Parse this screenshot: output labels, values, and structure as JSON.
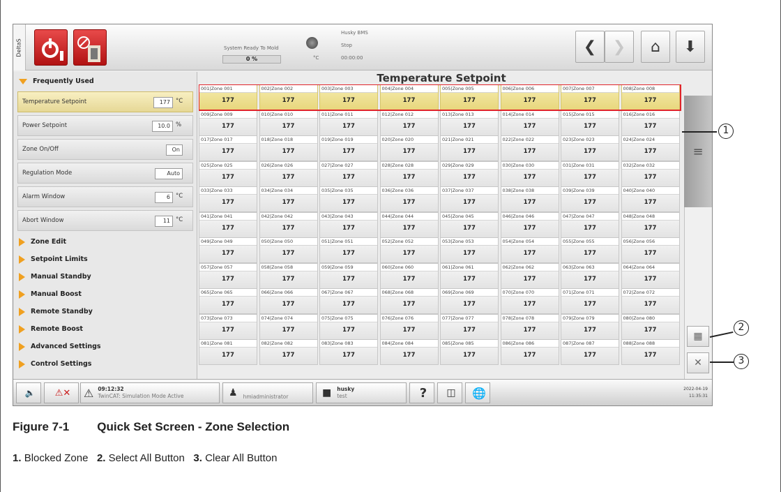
{
  "screen": {
    "vertical_tab": "DeltaS",
    "status_message": "System Ready To Mold",
    "progress_text": "0 %",
    "machine_name": "Husky BMS",
    "machine_state": "Stop",
    "unit_symbol": "°C",
    "timer": "00:00:00"
  },
  "sidebar": {
    "frequently_used": "Frequently Used",
    "params": [
      {
        "label": "Temperature Setpoint",
        "value": "177",
        "unit": "°C"
      },
      {
        "label": "Power Setpoint",
        "value": "10.0",
        "unit": "%"
      },
      {
        "label": "Zone On/Off",
        "value": "On",
        "unit": ""
      },
      {
        "label": "Regulation Mode",
        "value": "Auto",
        "unit": ""
      },
      {
        "label": "Alarm Window",
        "value": "6",
        "unit": "°C"
      },
      {
        "label": "Abort Window",
        "value": "11",
        "unit": "°C"
      }
    ],
    "sections": [
      "Zone Edit",
      "Setpoint Limits",
      "Manual Standby",
      "Manual Boost",
      "Remote Standby",
      "Remote Boost",
      "Advanced Settings",
      "Control Settings"
    ]
  },
  "main": {
    "title": "Temperature Setpoint",
    "zone_value": "177",
    "zones": [
      "001|Zone 001",
      "002|Zone 002",
      "003|Zone 003",
      "004|Zone 004",
      "005|Zone 005",
      "006|Zone 006",
      "007|Zone 007",
      "008|Zone 008",
      "009|Zone 009",
      "010|Zone 010",
      "011|Zone 011",
      "012|Zone 012",
      "013|Zone 013",
      "014|Zone 014",
      "015|Zone 015",
      "016|Zone 016",
      "017|Zone 017",
      "018|Zone 018",
      "019|Zone 019",
      "020|Zone 020",
      "021|Zone 021",
      "022|Zone 022",
      "023|Zone 023",
      "024|Zone 024",
      "025|Zone 025",
      "026|Zone 026",
      "027|Zone 027",
      "028|Zone 028",
      "029|Zone 029",
      "030|Zone 030",
      "031|Zone 031",
      "032|Zone 032",
      "033|Zone 033",
      "034|Zone 034",
      "035|Zone 035",
      "036|Zone 036",
      "037|Zone 037",
      "038|Zone 038",
      "039|Zone 039",
      "040|Zone 040",
      "041|Zone 041",
      "042|Zone 042",
      "043|Zone 043",
      "044|Zone 044",
      "045|Zone 045",
      "046|Zone 046",
      "047|Zone 047",
      "048|Zone 048",
      "049|Zone 049",
      "050|Zone 050",
      "051|Zone 051",
      "052|Zone 052",
      "053|Zone 053",
      "054|Zone 054",
      "055|Zone 055",
      "056|Zone 056",
      "057|Zone 057",
      "058|Zone 058",
      "059|Zone 059",
      "060|Zone 060",
      "061|Zone 061",
      "062|Zone 062",
      "063|Zone 063",
      "064|Zone 064",
      "065|Zone 065",
      "066|Zone 066",
      "067|Zone 067",
      "068|Zone 068",
      "069|Zone 069",
      "070|Zone 070",
      "071|Zone 071",
      "072|Zone 072",
      "073|Zone 073",
      "074|Zone 074",
      "075|Zone 075",
      "076|Zone 076",
      "077|Zone 077",
      "078|Zone 078",
      "079|Zone 079",
      "080|Zone 080",
      "081|Zone 081",
      "082|Zone 082",
      "083|Zone 083",
      "084|Zone 084",
      "085|Zone 085",
      "086|Zone 086",
      "087|Zone 087",
      "088|Zone 088"
    ],
    "blocked_row_count": 8
  },
  "bottombar": {
    "alarm_time": "09:12:32",
    "alarm_message": "TwinCAT: Simulation Mode Active",
    "user": "hmiadministrator",
    "mold_name": "husky",
    "mold_sub": "test",
    "date": "2022-04-19",
    "time": "11:35:31"
  },
  "callouts": [
    "1",
    "2",
    "3"
  ],
  "caption": {
    "figure": "Figure 7-1",
    "title": "Quick Set Screen - Zone Selection",
    "items": [
      {
        "num": "1.",
        "text": "Blocked Zone"
      },
      {
        "num": "2.",
        "text": "Select All Button"
      },
      {
        "num": "3.",
        "text": "Clear All Button"
      }
    ]
  },
  "colors": {
    "accent": "#f0a020",
    "blocked_outline": "#e0242b",
    "blocked_fill": "#f1e39c",
    "alarm_red": "#c81a1a"
  }
}
